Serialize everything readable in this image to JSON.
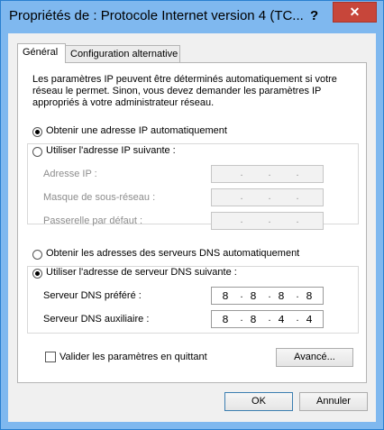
{
  "window": {
    "title": "Propriétés de : Protocole Internet version 4 (TC...",
    "help_symbol": "?",
    "close_symbol": "✕"
  },
  "tabs": [
    {
      "label": "Général"
    },
    {
      "label": "Configuration alternative"
    }
  ],
  "description": "Les paramètres IP peuvent être déterminés automatiquement si votre réseau le permet. Sinon, vous devez demander les paramètres IP appropriés à votre administrateur réseau.",
  "ip": {
    "auto_label": "Obtenir une adresse IP automatiquement",
    "manual_label": "Utiliser l'adresse IP suivante :",
    "address_label": "Adresse IP :",
    "mask_label": "Masque de sous-réseau :",
    "gateway_label": "Passerelle par défaut :"
  },
  "dns": {
    "auto_label": "Obtenir les adresses des serveurs DNS automatiquement",
    "manual_label": "Utiliser l'adresse de serveur DNS suivante :",
    "preferred_label": "Serveur DNS préféré :",
    "preferred_octets": [
      "8",
      "8",
      "8",
      "8"
    ],
    "alternate_label": "Serveur DNS auxiliaire :",
    "alternate_octets": [
      "8",
      "8",
      "4",
      "4"
    ]
  },
  "validate_label": "Valider les paramètres en quittant",
  "buttons": {
    "advanced": "Avancé...",
    "ok": "OK",
    "cancel": "Annuler"
  },
  "ip_separator": "."
}
